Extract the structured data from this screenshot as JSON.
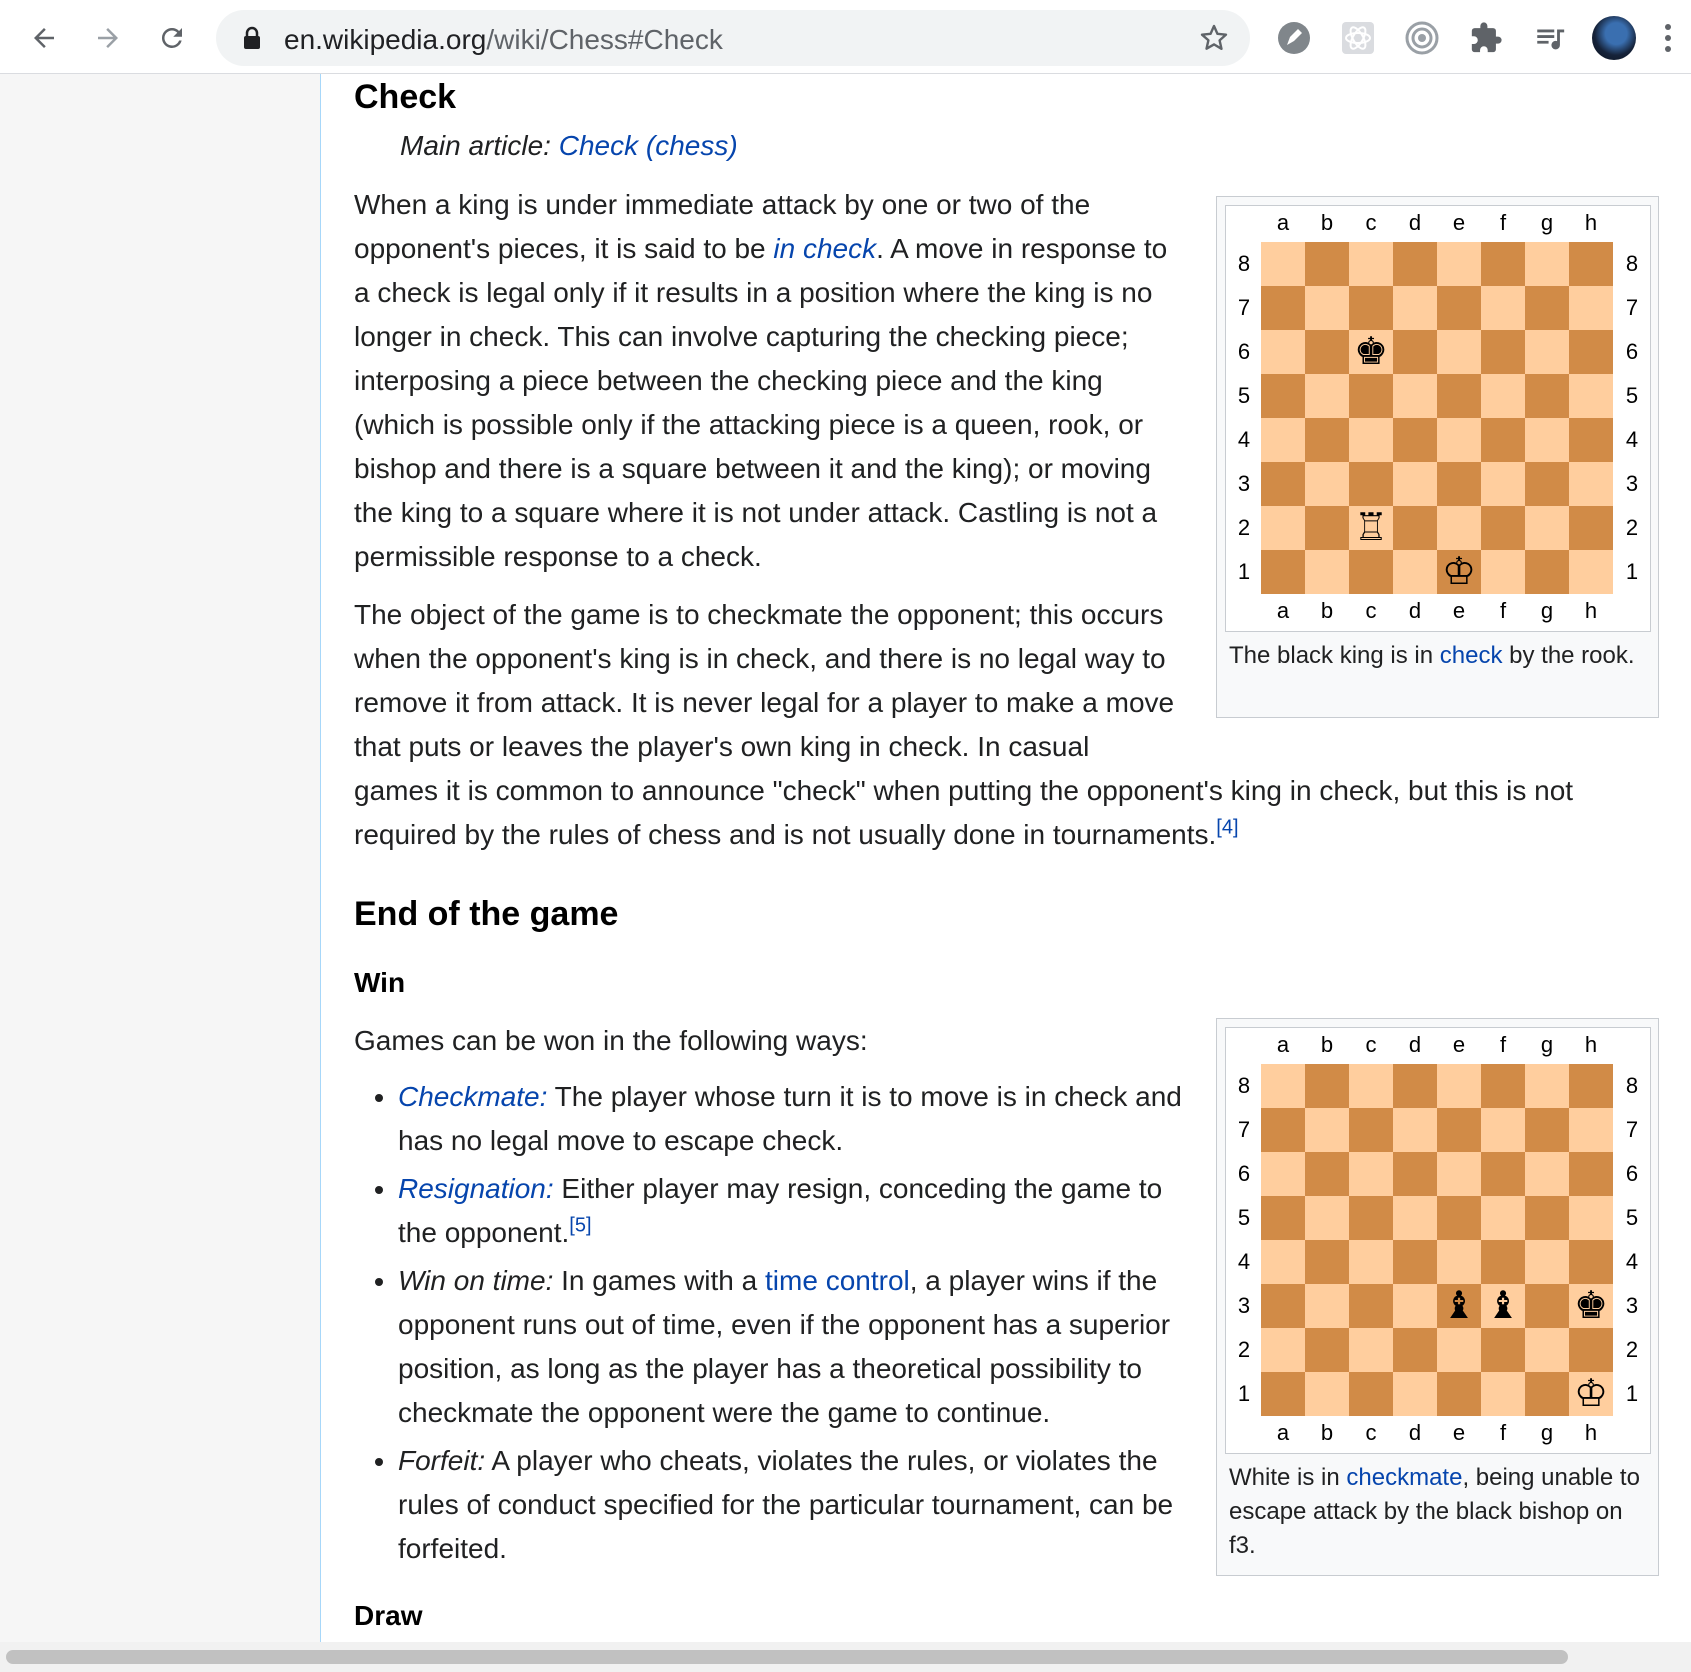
{
  "browser": {
    "url_host": "en.wikipedia.org",
    "url_path": "/wiki/Chess#Check"
  },
  "check": {
    "heading": "Check",
    "hatnote_prefix": "Main article: ",
    "hatnote_link": "Check (chess)",
    "p1_a": "When a king is under immediate attack by one or two of the opponent's pieces, it is said to be ",
    "p1_link": "in check",
    "p1_b": ". A move in response to a check is legal only if it results in a position where the king is no longer in check. This can involve capturing the checking piece; interposing a piece between the checking piece and the king (which is possible only if the attacking piece is a queen, rook, or bishop and there is a square between it and the king); or moving the king to a square where it is not under attack. Castling is not a permissible response to a check.",
    "p2_a": "The object of the game is to checkmate the opponent; this occurs when the opponent's king is in check, and there is no legal way to remove it from attack. It is never legal for a player to make a move that puts or leaves the player's own king in check. In casual",
    "p2_b": "games it is common to announce \"check\" when putting the opponent's king in check, but this is not required by the rules of chess and is not usually done in tournaments.",
    "p2_ref": "[4]"
  },
  "figure1": {
    "files": [
      "a",
      "b",
      "c",
      "d",
      "e",
      "f",
      "g",
      "h"
    ],
    "ranks": [
      "8",
      "7",
      "6",
      "5",
      "4",
      "3",
      "2",
      "1"
    ],
    "pieces": [
      {
        "square": "c6",
        "glyph": "♚",
        "piece": "black-king"
      },
      {
        "square": "c2",
        "glyph": "♖",
        "piece": "white-rook"
      },
      {
        "square": "e1",
        "glyph": "♔",
        "piece": "white-king"
      }
    ],
    "caption_a": "The black king is in ",
    "caption_link": "check",
    "caption_b": " by the rook."
  },
  "end": {
    "heading": "End of the game",
    "win_heading": "Win",
    "intro": "Games can be won in the following ways:",
    "items": [
      {
        "term": "Checkmate:",
        "linked": true,
        "text": " The player whose turn it is to move is in check and has no legal move to escape check."
      },
      {
        "term": "Resignation:",
        "linked": true,
        "text": " Either player may resign, conceding the game to the opponent.",
        "ref": "[5]"
      },
      {
        "term": "Win on time:",
        "linked": false,
        "text_a": " In games with a ",
        "link": "time control",
        "text_b": ", a player wins if the opponent runs out of time, even if the opponent has a superior position, as long as the player has a theoretical possibility to checkmate the opponent were the game to continue."
      },
      {
        "term": "Forfeit:",
        "linked": false,
        "text": " A player who cheats, violates the rules, or violates the rules of conduct specified for the particular tournament, can be forfeited."
      }
    ],
    "draw_heading": "Draw"
  },
  "figure2": {
    "pieces": [
      {
        "square": "e3",
        "glyph": "♝",
        "piece": "black-bishop"
      },
      {
        "square": "f3",
        "glyph": "♝",
        "piece": "black-bishop"
      },
      {
        "square": "h3",
        "glyph": "♚",
        "piece": "black-king"
      },
      {
        "square": "h1",
        "glyph": "♔",
        "piece": "white-king"
      }
    ],
    "caption_a": "White is in ",
    "caption_link": "checkmate",
    "caption_b": ", being unable to escape attack by the black bishop on f3."
  },
  "icons": [
    "back-arrow-icon",
    "forward-arrow-icon",
    "reload-icon",
    "lock-icon",
    "star-icon",
    "extensions-icon",
    "media-icon"
  ],
  "colors": {
    "link": "#0645ad",
    "light_square": "#ffce9e",
    "dark_square": "#d18b47"
  }
}
